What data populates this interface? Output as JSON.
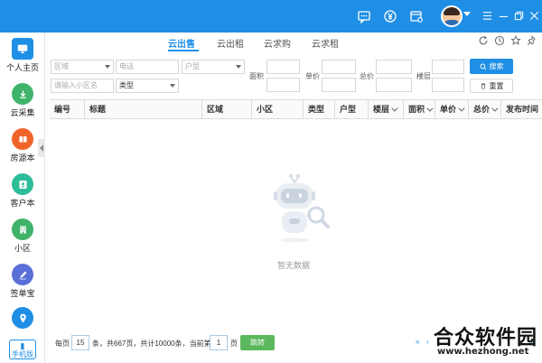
{
  "colors": {
    "primary": "#1f8fe6",
    "go_button": "#5cb85c"
  },
  "titlebar": {
    "icons": [
      "message-icon",
      "yen-coin-icon",
      "settings-card-icon"
    ],
    "window_controls": [
      "menu-icon",
      "minimize-icon",
      "restore-icon",
      "close-icon"
    ]
  },
  "sidebar": {
    "items": [
      {
        "label": "个人主页",
        "icon": "monitor-icon",
        "color": "#1f8fe6"
      },
      {
        "label": "云采集",
        "icon": "download-icon",
        "color": "#3fb36a"
      },
      {
        "label": "房源本",
        "icon": "book-icon",
        "color": "#f0642a"
      },
      {
        "label": "客户本",
        "icon": "contact-icon",
        "color": "#2dbd9a"
      },
      {
        "label": "小区",
        "icon": "building-icon",
        "color": "#3fb36a"
      },
      {
        "label": "签单宝",
        "icon": "pen-icon",
        "color": "#5a6fd8"
      },
      {
        "label": "",
        "icon": "location-icon",
        "color": "#1f8fe6"
      }
    ],
    "mobile_label": "手机版"
  },
  "tabs": [
    "云出售",
    "云出租",
    "云求购",
    "云求租"
  ],
  "filters": {
    "region_placeholder": "区域",
    "phone_placeholder": "电话",
    "layout_placeholder": "户型",
    "area_label": "面积",
    "unit_price_label": "单价",
    "total_price_label": "总价",
    "floor_label": "楼层",
    "community_placeholder": "请输入小区名",
    "type_value": "类型",
    "search_label": "搜索",
    "reset_label": "重置"
  },
  "table": {
    "columns": [
      "编号",
      "标题",
      "区域",
      "小区",
      "类型",
      "户型",
      "楼层",
      "面积",
      "单价",
      "总价",
      "发布时间"
    ]
  },
  "empty_state": {
    "text": "暂无数据"
  },
  "pagination": {
    "per_page_prefix": "每页",
    "per_page": "15",
    "summary": "条，共667页，共计10000条，当前第",
    "current_page": "1",
    "page_suffix": "页",
    "go_label": "跳转"
  },
  "watermark": {
    "brand": "合众软件园",
    "url": "www.hezhong.net"
  }
}
